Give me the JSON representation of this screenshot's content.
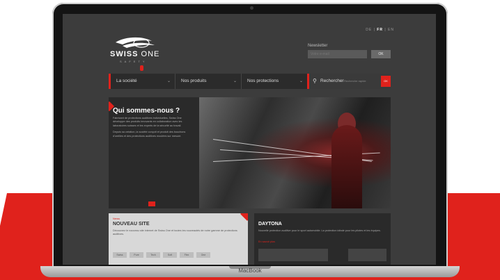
{
  "device": {
    "brand_label": "MacBook"
  },
  "site": {
    "languages": [
      "DE",
      "FR",
      "EN"
    ],
    "active_language": "FR",
    "logo": {
      "word_bold": "SWISS",
      "word_light": "ONE",
      "tagline": "SAFETY"
    },
    "newsletter": {
      "label": "Newsletter",
      "placeholder": "Votre e-mail",
      "button": "OK"
    },
    "nav": {
      "items": [
        {
          "label": "La société",
          "chevron": "⌄"
        },
        {
          "label": "Nos produits",
          "chevron": "⌄"
        },
        {
          "label": "Nos protections",
          "chevron": "⌄"
        }
      ],
      "search_label": "Rechercher",
      "search_placeholder": "Recherche rapide",
      "search_button": "OK"
    },
    "hero": {
      "title": "Qui sommes-nous ?",
      "paragraphs": [
        "Fabricant de protections auditives individuelles, Swiss One développe des produits innovants en collaboration avec les laboratoires suisses et les experts de la sécurité au travail.",
        "Depuis sa création, la société conçoit et produit des bouchons d'oreilles et des protections auditives moulées sur mesure."
      ]
    },
    "news": {
      "label": "News",
      "title": "NOUVEAU SITE",
      "text": "Découvrez le nouveau site internet de Swiss One et toutes les nouveautés de notre gamme de protections auditives.",
      "logos": [
        "Swiss",
        "Pure",
        "Tech",
        "Soft",
        "Flex",
        "One"
      ]
    },
    "daytona": {
      "title": "DAYTONA",
      "text": "Nouvelle protection auditive pour le sport automobile. La protection idéale pour les pilotes et les équipes.",
      "link": "En savoir plus"
    }
  }
}
